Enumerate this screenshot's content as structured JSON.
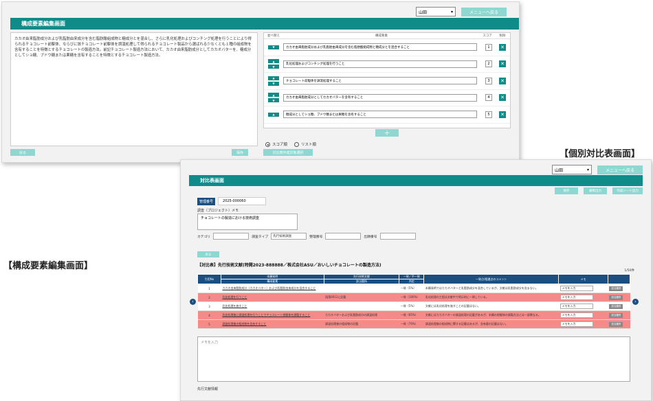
{
  "captions": {
    "edit": "【構成要素編集画面】",
    "compare": "【個別対比表画面】"
  },
  "edit_window": {
    "user_select": "山田",
    "menu_button": "メニューへ戻る",
    "title": "構成要素編集画面",
    "description": "カカオ由来脂肪成分および乳脂肪由来成分を含む脂肪酸組成物と糖成分とを混合し、さらに乳化処理およびコンチング処理を行うことにより得られるチョコレート前駆体、ならびに該チョコレート前駆体を調温処理して得られるチョコレート製品から選ばれる少なくとも１種の組成物を含有することを特徴とするチョコレートの製造方法。前記チョコレート製造方法において、カカオ由来脂肪成分としてカカオバターを、糖成分としてショ糖、ブドウ糖または果糖を含有することを特徴とするチョコレート製造方法。",
    "columns": {
      "order": "並べ替え",
      "element": "構成要素",
      "score": "スコア",
      "delete": "削除"
    },
    "elements": [
      {
        "text": "カカオ由来脂肪成分および乳脂肪由来成分を含む脂肪酸組成物と糖成分とを混合すること",
        "score": "1"
      },
      {
        "text": "乳化処理およびコンチング処理を行うこと",
        "score": "2"
      },
      {
        "text": "チョコレート前駆体を調温処理すること",
        "score": "3"
      },
      {
        "text": "カカオ由来脂肪成分としてカカオバターを含有すること",
        "score": "4"
      },
      {
        "text": "糖成分としてショ糖、ブドウ糖または果糖を含有すること",
        "score": "5"
      }
    ],
    "add_button": "＋",
    "radio_score": "スコア順",
    "radio_list": "リスト順",
    "back_button": "戻る",
    "save_button": "保存",
    "create_button": "対比表作成対象選択"
  },
  "compare_window": {
    "user_select": "山田",
    "menu_button": "メニューへ戻る",
    "title": "対比表画面",
    "actions": {
      "save": "保存",
      "duplicate": "複製出力",
      "export": "作成シート出力"
    },
    "management_label": "管理番号",
    "management_value": "2025-000060",
    "memo_label": "調査（プロジェクト）メモ",
    "memo_value": "チョコレートの製造における技術調査",
    "meta": {
      "category_label": "カテゴリ",
      "category_value": "",
      "type_label": "調査タイプ",
      "type_value": "先行技術調査",
      "ref_label": "整理番号",
      "ref_value": "",
      "app_label": "出願番号",
      "app_value": ""
    },
    "small_button": "戻る",
    "table_title": "【対比表】先行技術文献(特開2023-888888／株式会社ASU／おいしいチョコレートの製造方法)",
    "pager": "1/50件",
    "headers": {
      "no": "引用No",
      "element": "構成要素",
      "passage": "該当箇所",
      "judge": "判定",
      "comment": "一致点/相違点のコメント",
      "memo": "メモ",
      "action": ""
    },
    "group_headers": {
      "target": "本願発明",
      "prior": "先行技術文献",
      "match": "一致／不一致",
      "comment": "一致点/相違点のコメント"
    },
    "rows": [
      {
        "no": "1",
        "element": "カカオ由来脂肪成分（カカオバター）および乳脂肪由来成分を混合すること",
        "passage": "",
        "judge": "一致（5%）",
        "comment": "本願発明ではカカオバターと乳脂肪成分を混合しているが、文献は乳脂肪成分を含まない。",
        "memo": "メモを入力",
        "button": "該当箇所",
        "highlight": false
      },
      {
        "no": "2",
        "element": "乳化処理を行うこと",
        "passage": "段落0012に記載",
        "judge": "一致（100%）",
        "comment": "乳化処理の工程は文献中で明示的に一致している。",
        "memo": "メモを入力",
        "button": "該当箇所",
        "highlight": true
      },
      {
        "no": "3",
        "element": "乳化処理を施すこと",
        "passage": "",
        "judge": "一致（5%）",
        "comment": "文献には乳化処理を施すことの記載はない。",
        "memo": "メモを入力",
        "button": "該当箇所",
        "highlight": false
      },
      {
        "no": "4",
        "element": "乳化処理後に調温処理を行うことでチョコレート前駆体を調製すること",
        "passage": "カカオバターおよび乳脂肪成分の調温処理",
        "judge": "一致（85%）",
        "comment": "文献にはカカオバターの調温処理の記載があるが、本願の前駆体の調製方法とは一部異なる。",
        "memo": "メモを入力",
        "button": "該当箇所",
        "highlight": true
      },
      {
        "no": "5",
        "element": "調温処理後の組成物を含有すること",
        "passage": "調温処理後の組成物の記載",
        "judge": "一致（70%）",
        "comment": "調温処理後の組成物に関する記載はあるが、含有量の記載はない。",
        "memo": "メモを入力",
        "button": "該当箇所",
        "highlight": true
      }
    ],
    "big_memo_placeholder": "メモを入力",
    "footer_label": "先行文献情報"
  }
}
